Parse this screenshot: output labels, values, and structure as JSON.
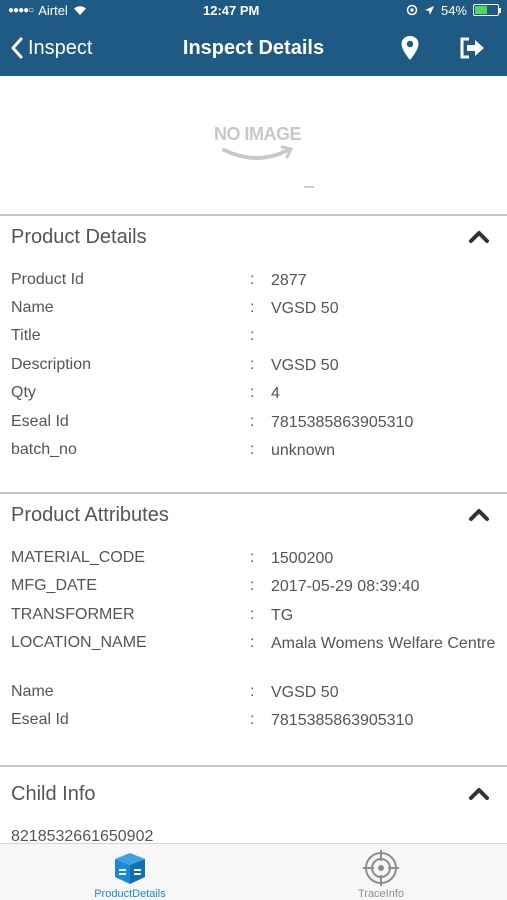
{
  "status_bar": {
    "carrier": "Airtel",
    "time": "12:47 PM",
    "battery": "54%"
  },
  "nav": {
    "back_label": "Inspect",
    "title": "Inspect Details",
    "location_icon": "map-pin-icon",
    "exit_icon": "sign-out-icon"
  },
  "image": {
    "placeholder_text": "NO IMAGE"
  },
  "product_details": {
    "title": "Product Details",
    "rows": [
      {
        "label": "Product Id",
        "value": "2877"
      },
      {
        "label": "Name",
        "value": "VGSD 50"
      },
      {
        "label": "Title",
        "value": ""
      },
      {
        "label": "Description",
        "value": "VGSD 50"
      },
      {
        "label": "Qty",
        "value": "4"
      },
      {
        "label": "Eseal Id",
        "value": "7815385863905310"
      },
      {
        "label": "batch_no",
        "value": "unknown"
      }
    ]
  },
  "product_attributes": {
    "title": "Product Attributes",
    "rows": [
      {
        "label": "MATERIAL_CODE",
        "value": "1500200"
      },
      {
        "label": "MFG_DATE",
        "value": "2017-05-29 08:39:40"
      },
      {
        "label": "TRANSFORMER",
        "value": "TG"
      },
      {
        "label": "LOCATION_NAME",
        "value": "Amala Womens Welfare Centre"
      },
      {
        "label": "Name",
        "value": "VGSD 50"
      },
      {
        "label": "Eseal Id",
        "value": "7815385863905310"
      }
    ]
  },
  "child_info": {
    "title": "Child Info",
    "items": [
      "8218532661650902"
    ]
  },
  "tabs": [
    {
      "label": "ProductDetails",
      "icon": "box-icon",
      "active": true
    },
    {
      "label": "TraceInfo",
      "icon": "crosshair-icon",
      "active": false
    }
  ],
  "colors": {
    "nav_bg": "#1f5a84",
    "active_tab": "#1a8ad6",
    "inactive_tab": "#8e8e8e"
  },
  "separator": ":"
}
